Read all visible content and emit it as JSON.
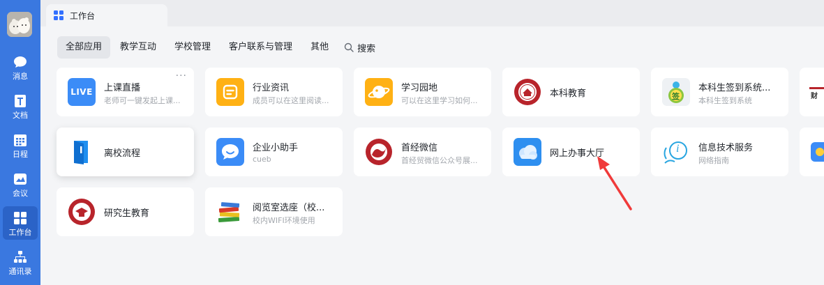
{
  "sidebar": {
    "items": [
      {
        "label": "消息",
        "icon": "chat-bubble-icon"
      },
      {
        "label": "文档",
        "icon": "document-icon"
      },
      {
        "label": "日程",
        "icon": "calendar-icon"
      },
      {
        "label": "会议",
        "icon": "meeting-icon"
      },
      {
        "label": "工作台",
        "icon": "grid-icon"
      },
      {
        "label": "通讯录",
        "icon": "org-chart-icon"
      }
    ]
  },
  "tab": {
    "label": "工作台"
  },
  "categories": [
    "全部应用",
    "教学互动",
    "学校管理",
    "客户联系与管理",
    "其他"
  ],
  "search_label": "搜索",
  "apps": [
    {
      "title": "上课直播",
      "desc": "老师可一键发起上课...",
      "icon_text": "LIVE"
    },
    {
      "title": "行业资讯",
      "desc": "成员可以在这里阅读..."
    },
    {
      "title": "学习园地",
      "desc": "可以在这里学习如何..."
    },
    {
      "title": "本科教育",
      "desc": ""
    },
    {
      "title": "本科生签到系统...",
      "desc": "本科生签到系统",
      "icon_text": "签"
    },
    {
      "title": "离校流程",
      "desc": ""
    },
    {
      "title": "企业小助手",
      "desc": "cueb"
    },
    {
      "title": "首经微信",
      "desc": "首经贸微信公众号展..."
    },
    {
      "title": "网上办事大厅",
      "desc": ""
    },
    {
      "title": "信息技术服务",
      "desc": "网络指南",
      "icon_text": "i"
    },
    {
      "title": "研究生教育",
      "desc": ""
    },
    {
      "title": "阅览室选座（校...",
      "desc": "校内WIFI环境使用"
    }
  ],
  "partial_card": {
    "icon_text": "财"
  },
  "colors": {
    "sidebar": "#3a78e0",
    "accent": "#3370ff",
    "arrow": "#f03a3a"
  }
}
